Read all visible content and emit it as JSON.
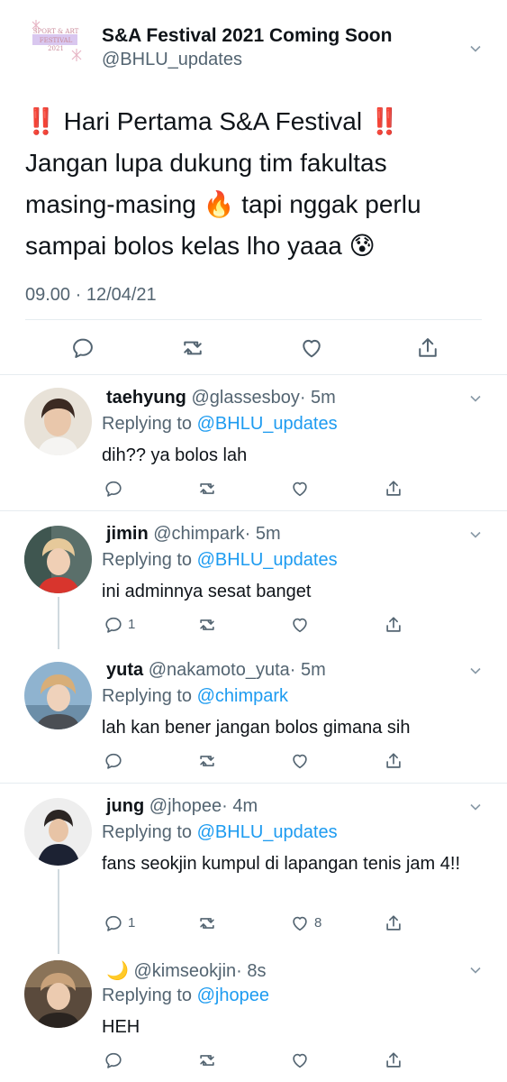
{
  "main_tweet": {
    "avatar_text": [
      "SPORT & ART",
      "FESTIVAL",
      "2021"
    ],
    "name": "S&A Festival 2021 Coming Soon",
    "handle": "@BHLU_updates",
    "text_lines": [
      "‼️ Hari Pertama S&A Festival ‼️",
      "Jangan lupa dukung tim fakultas",
      "masing-masing 🔥 tapi nggak perlu",
      "sampai bolos kelas lho yaaa 😰"
    ],
    "timestamp": "09.00 · 12/04/21"
  },
  "replies": [
    {
      "name": "taehyung",
      "handle": "@glassesboy",
      "time": "· 5m",
      "replying_prefix": "Replying to ",
      "replying_to": "@BHLU_updates",
      "text": "dih?? ya bolos lah",
      "reply_count": "",
      "like_count": ""
    },
    {
      "name": "jimin",
      "handle": "@chimpark",
      "time": "· 5m",
      "replying_prefix": "Replying to ",
      "replying_to": "@BHLU_updates",
      "text": "ini adminnya sesat banget",
      "reply_count": "1",
      "like_count": ""
    },
    {
      "name": "yuta",
      "handle": "@nakamoto_yuta",
      "time": "· 5m",
      "replying_prefix": "Replying to ",
      "replying_to": "@chimpark",
      "text": "lah kan bener jangan bolos gimana sih",
      "reply_count": "",
      "like_count": ""
    },
    {
      "name": "jung",
      "handle": "@jhopee",
      "time": "· 4m",
      "replying_prefix": "Replying to ",
      "replying_to": "@BHLU_updates",
      "text": "fans seokjin kumpul di lapangan tenis jam 4!!",
      "reply_count": "1",
      "like_count": "8"
    },
    {
      "name": "🌙",
      "handle": "@kimseokjin",
      "time": "· 8s",
      "replying_prefix": "Replying to ",
      "replying_to": "@jhopee",
      "text": "HEH",
      "reply_count": "",
      "like_count": ""
    }
  ],
  "icons": {
    "reply": "reply-icon",
    "retweet": "retweet-icon",
    "like": "like-icon",
    "share": "share-icon",
    "more": "chevron-down-icon"
  },
  "colors": {
    "text": "#0f1419",
    "secondary": "#536471",
    "link": "#1d9bf0",
    "divider": "#e6ecf0",
    "thread_line": "#cfd9de"
  }
}
